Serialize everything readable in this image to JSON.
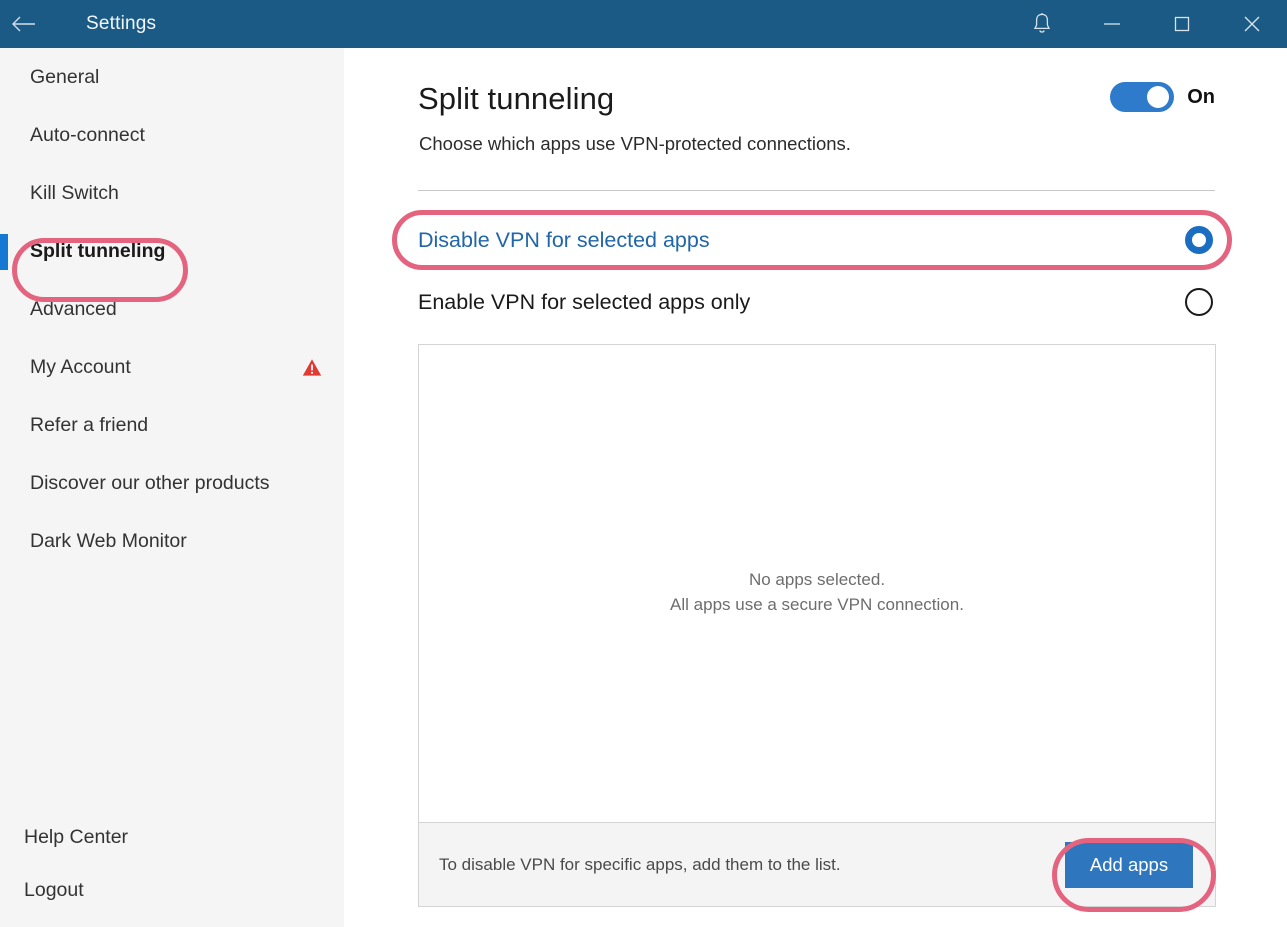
{
  "window": {
    "title": "Settings",
    "back_icon": "back-arrow-icon",
    "notifications_icon": "bell-icon",
    "minimize_icon": "minimize-icon",
    "maximize_icon": "maximize-icon",
    "close_icon": "close-icon",
    "titlebar_color": "#1A5A85"
  },
  "sidebar": {
    "background": "#F5F5F5",
    "active_indicator_color": "#1578D3",
    "items": [
      {
        "label": "General",
        "active": false
      },
      {
        "label": "Auto-connect",
        "active": false
      },
      {
        "label": "Kill Switch",
        "active": false
      },
      {
        "label": "Split tunneling",
        "active": true
      },
      {
        "label": "Advanced",
        "active": false
      },
      {
        "label": "My Account",
        "active": false,
        "badge_icon": "warning-triangle-icon",
        "badge_color": "#E03A35"
      },
      {
        "label": "Refer a friend",
        "active": false
      },
      {
        "label": "Discover our other products",
        "active": false
      },
      {
        "label": "Dark Web Monitor",
        "active": false
      }
    ],
    "bottom_items": [
      {
        "label": "Help Center"
      },
      {
        "label": "Logout"
      }
    ]
  },
  "main": {
    "title": "Split tunneling",
    "subtitle": "Choose which apps use VPN-protected connections.",
    "toggle": {
      "state_label": "On",
      "enabled": true,
      "color": "#2F7BCB"
    },
    "options": [
      {
        "label": "Disable VPN for selected apps",
        "selected": true
      },
      {
        "label": "Enable VPN for selected apps only",
        "selected": false
      }
    ],
    "selected_option_color": "#2166A8",
    "apps_panel": {
      "empty_line_1": "No apps selected.",
      "empty_line_2": "All apps use a secure VPN connection.",
      "footer_hint": "To disable VPN for specific apps, add them to the list.",
      "add_button_label": "Add apps",
      "add_button_color": "#2E76BD"
    }
  },
  "annotations": {
    "color": "#E4647F",
    "highlights": [
      "sidebar-item-split-tunneling",
      "option-disable-vpn-for-selected-apps",
      "add-apps-button"
    ]
  }
}
